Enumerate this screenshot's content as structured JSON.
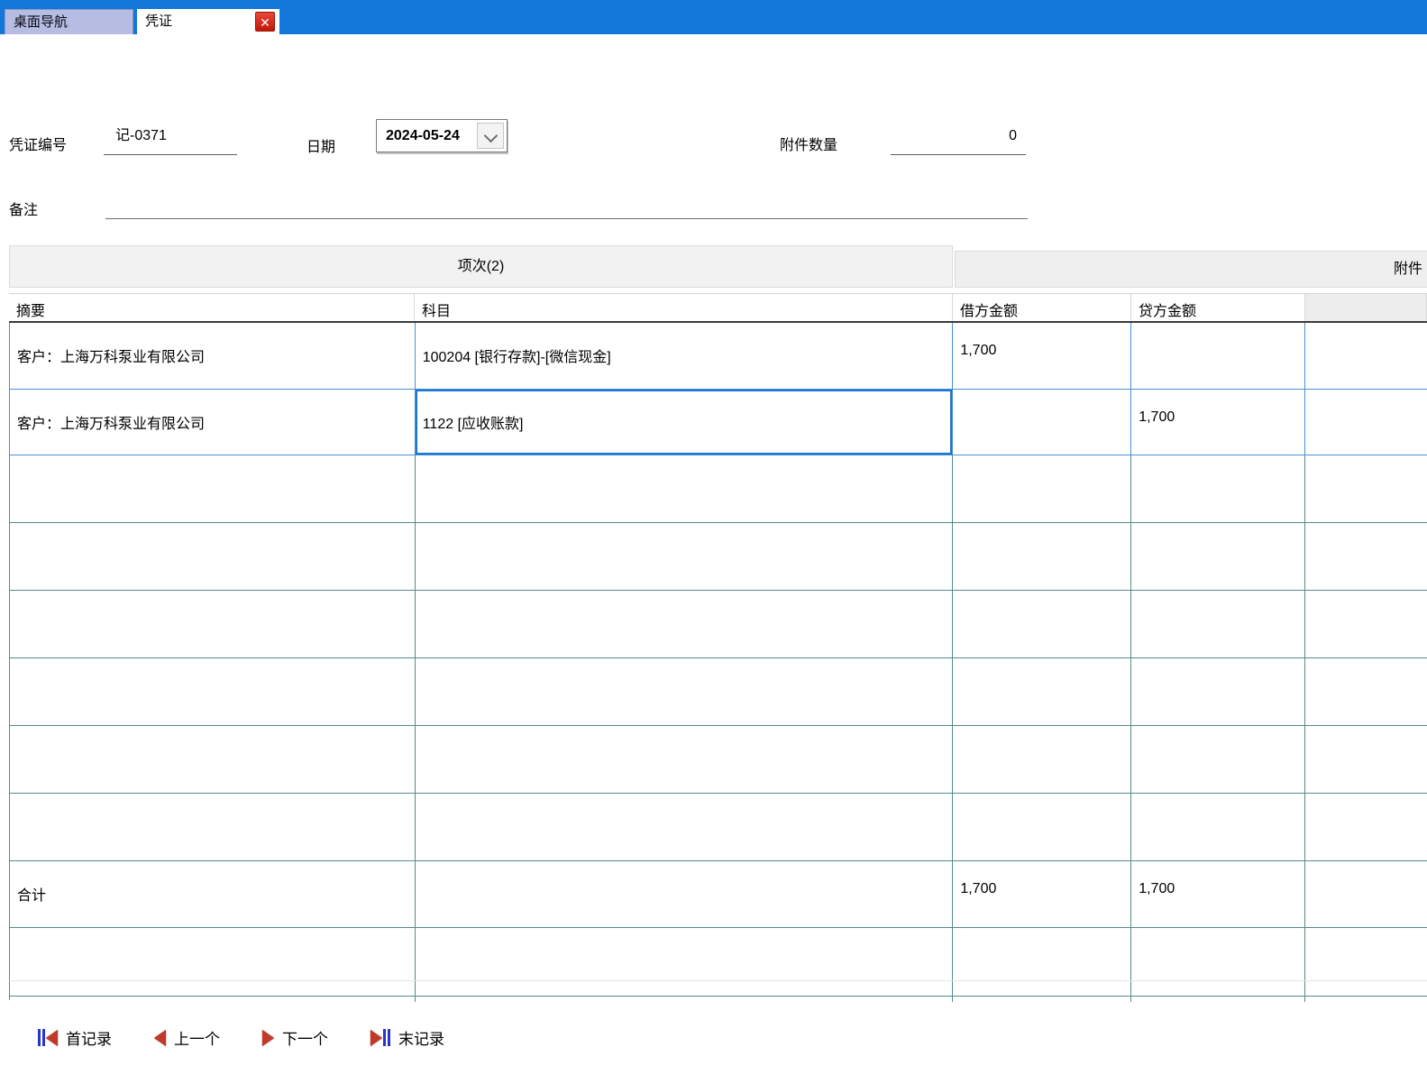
{
  "titlebar": {
    "tabs": [
      {
        "label": "桌面导航"
      },
      {
        "label": "凭证"
      }
    ],
    "close_icon": "✕"
  },
  "form": {
    "voucher_no_label": "凭证编号",
    "voucher_no_value": "记-0371",
    "date_label": "日期",
    "date_value": "2024-05-24",
    "attachment_count_label": "附件数量",
    "attachment_count_value": "0",
    "remarks_label": "备注",
    "remarks_value": ""
  },
  "sections": {
    "items_label": "项次(2)",
    "attachments_label": "附件"
  },
  "table": {
    "columns": [
      "摘要",
      "科目",
      "借方金额",
      "贷方金额"
    ],
    "rows": [
      {
        "summary": "客户：上海万科泵业有限公司",
        "account": "100204 [银行存款]-[微信现金]",
        "debit": "1,700",
        "credit": ""
      },
      {
        "summary": "客户：上海万科泵业有限公司",
        "account": "1122 [应收账款]",
        "debit": "",
        "credit": "1,700"
      }
    ],
    "total_label": "合计",
    "total_debit": "1,700",
    "total_credit": "1,700"
  },
  "nav": {
    "first_label": "首记录",
    "prev_label": "上一个",
    "next_label": "下一个",
    "last_label": "末记录"
  }
}
